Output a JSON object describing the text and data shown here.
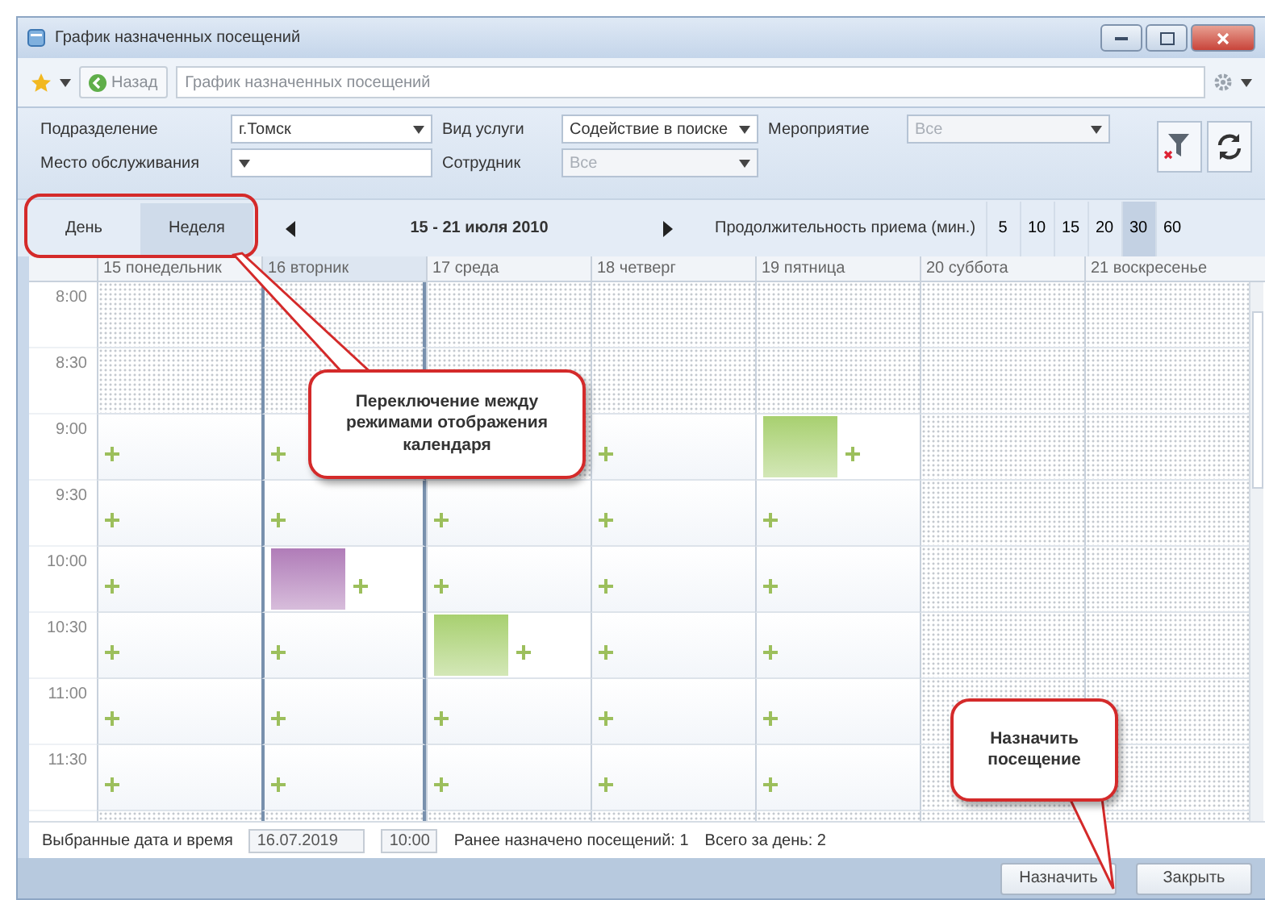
{
  "window": {
    "title": "График назначенных посещений"
  },
  "toolbar": {
    "back": "Назад",
    "address": "График назначенных посещений"
  },
  "filters": [
    [
      {
        "label": "Подразделение",
        "value": "г.Томск",
        "disabled": false
      },
      {
        "label": "Вид услуги",
        "value": "Содействие в поиске",
        "disabled": false
      },
      {
        "label": "Мероприятие",
        "value": "Все",
        "disabled": true
      }
    ],
    [
      {
        "label": "Место обслуживания",
        "disabled": false
      },
      {
        "label": "Сотрудник",
        "value": "Все",
        "disabled": true
      }
    ]
  ],
  "view_modes": [
    {
      "label": "День",
      "selected": false
    },
    {
      "label": "Неделя",
      "selected": true
    }
  ],
  "period": "15 - 21 июля 2010",
  "duration": {
    "label": "Продолжительность приема (мин.)",
    "options": [
      {
        "label": "5",
        "selected": false
      },
      {
        "label": "10",
        "selected": false
      },
      {
        "label": "15",
        "selected": false
      },
      {
        "label": "20",
        "selected": false
      },
      {
        "label": "30",
        "selected": true
      },
      {
        "label": "60",
        "selected": false
      }
    ]
  },
  "calendar": {
    "days": [
      {
        "label": "15 понедельник",
        "selected": false
      },
      {
        "label": "16 вторник",
        "selected": true
      },
      {
        "label": "17 среда",
        "selected": false
      },
      {
        "label": "18 четверг",
        "selected": false
      },
      {
        "label": "19 пятница",
        "selected": false
      },
      {
        "label": "20 суббота",
        "selected": false
      },
      {
        "label": "21 воскресенье",
        "selected": false
      }
    ],
    "rows": [
      {
        "time": "8:00",
        "cells": [
          {
            "kind": "blocked"
          },
          {
            "kind": "blocked"
          },
          {
            "kind": "blocked"
          },
          {
            "kind": "blocked"
          },
          {
            "kind": "blocked"
          },
          {
            "kind": "blocked"
          },
          {
            "kind": "blocked"
          }
        ]
      },
      {
        "time": "8:30",
        "cells": [
          {
            "kind": "blocked"
          },
          {
            "kind": "blocked"
          },
          {
            "kind": "blocked"
          },
          {
            "kind": "blocked"
          },
          {
            "kind": "blocked"
          },
          {
            "kind": "blocked"
          },
          {
            "kind": "blocked"
          }
        ]
      },
      {
        "time": "9:00",
        "cells": [
          {
            "kind": "free"
          },
          {
            "kind": "free"
          },
          {
            "kind": "blocked"
          },
          {
            "kind": "free"
          },
          {
            "kind": "booked",
            "color": "#a8d070"
          },
          {
            "kind": "blocked"
          },
          {
            "kind": "blocked"
          }
        ]
      },
      {
        "time": "9:30",
        "cells": [
          {
            "kind": "free"
          },
          {
            "kind": "free"
          },
          {
            "kind": "free"
          },
          {
            "kind": "free"
          },
          {
            "kind": "free"
          },
          {
            "kind": "blocked"
          },
          {
            "kind": "blocked"
          }
        ]
      },
      {
        "time": "10:00",
        "cells": [
          {
            "kind": "free"
          },
          {
            "kind": "booked",
            "color": "#b07cb8"
          },
          {
            "kind": "free"
          },
          {
            "kind": "free"
          },
          {
            "kind": "free"
          },
          {
            "kind": "blocked"
          },
          {
            "kind": "blocked"
          }
        ]
      },
      {
        "time": "10:30",
        "cells": [
          {
            "kind": "free"
          },
          {
            "kind": "free"
          },
          {
            "kind": "booked",
            "color": "#a8d070"
          },
          {
            "kind": "free"
          },
          {
            "kind": "free"
          },
          {
            "kind": "blocked"
          },
          {
            "kind": "blocked"
          }
        ]
      },
      {
        "time": "11:00",
        "cells": [
          {
            "kind": "free"
          },
          {
            "kind": "free"
          },
          {
            "kind": "free"
          },
          {
            "kind": "free"
          },
          {
            "kind": "free"
          },
          {
            "kind": "blocked"
          },
          {
            "kind": "blocked"
          }
        ]
      },
      {
        "time": "11:30",
        "cells": [
          {
            "kind": "free"
          },
          {
            "kind": "free"
          },
          {
            "kind": "free"
          },
          {
            "kind": "free"
          },
          {
            "kind": "free"
          },
          {
            "kind": "blocked"
          },
          {
            "kind": "blocked"
          }
        ]
      }
    ]
  },
  "info": {
    "label": "Выбранные дата и время",
    "date": "16.07.2019",
    "time": "10:00",
    "earlier": "Ранее назначено посещений: 1",
    "total": "Всего за день: 2"
  },
  "buttons": [
    "Назначить",
    "Закрыть"
  ],
  "annotations": [
    {
      "text": "Переключение между режимами отображения календаря"
    },
    {
      "text": "Назначить посещение"
    }
  ]
}
